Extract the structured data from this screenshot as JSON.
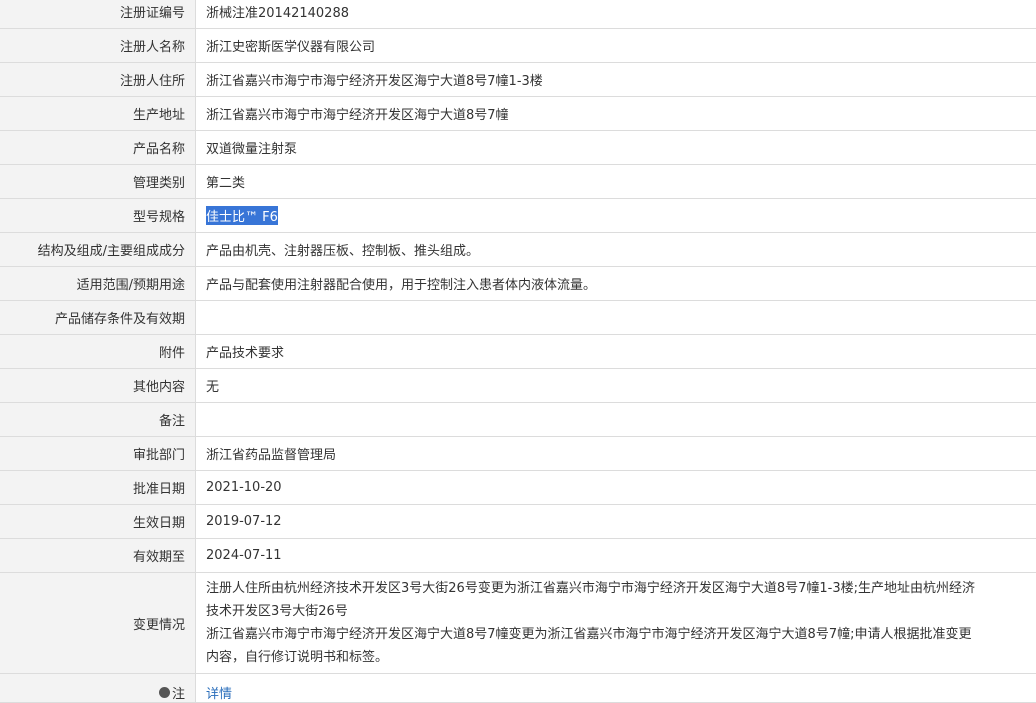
{
  "rows": [
    {
      "label": "注册证编号",
      "value": "浙械注准20142140288"
    },
    {
      "label": "注册人名称",
      "value": "浙江史密斯医学仪器有限公司"
    },
    {
      "label": "注册人住所",
      "value": "浙江省嘉兴市海宁市海宁经济开发区海宁大道8号7幢1-3楼"
    },
    {
      "label": "生产地址",
      "value": "浙江省嘉兴市海宁市海宁经济开发区海宁大道8号7幢"
    },
    {
      "label": "产品名称",
      "value": "双道微量注射泵"
    },
    {
      "label": "管理类别",
      "value": "第二类"
    },
    {
      "label": "型号规格",
      "value": "佳士比™ F6"
    },
    {
      "label": "结构及组成/主要组成成分",
      "value": "产品由机壳、注射器压板、控制板、推头组成。"
    },
    {
      "label": "适用范围/预期用途",
      "value": "产品与配套使用注射器配合使用，用于控制注入患者体内液体流量。"
    },
    {
      "label": "产品储存条件及有效期",
      "value": ""
    },
    {
      "label": "附件",
      "value": "产品技术要求"
    },
    {
      "label": "其他内容",
      "value": "无"
    },
    {
      "label": "备注",
      "value": ""
    },
    {
      "label": "审批部门",
      "value": "浙江省药品监督管理局"
    },
    {
      "label": "批准日期",
      "value": "2021-10-20"
    },
    {
      "label": "生效日期",
      "value": "2019-07-12"
    },
    {
      "label": "有效期至",
      "value": "2024-07-11"
    }
  ],
  "change": {
    "label": "变更情况",
    "lines": [
      "注册人住所由杭州经济技术开发区3号大街26号变更为浙江省嘉兴市海宁市海宁经济开发区海宁大道8号7幢1-3楼;生产地址由杭州经济",
      "技术开发区3号大街26号",
      "浙江省嘉兴市海宁市海宁经济开发区海宁大道8号7幢变更为浙江省嘉兴市海宁市海宁经济开发区海宁大道8号7幢;申请人根据批准变更",
      "内容，自行修订说明书和标签。"
    ]
  },
  "note": {
    "label": "注",
    "link": "详情"
  },
  "colors": {
    "label_bg": "#f3f3f3",
    "border": "#dcdcdc",
    "selection": "#3875d7",
    "link": "#2a6ebb"
  }
}
